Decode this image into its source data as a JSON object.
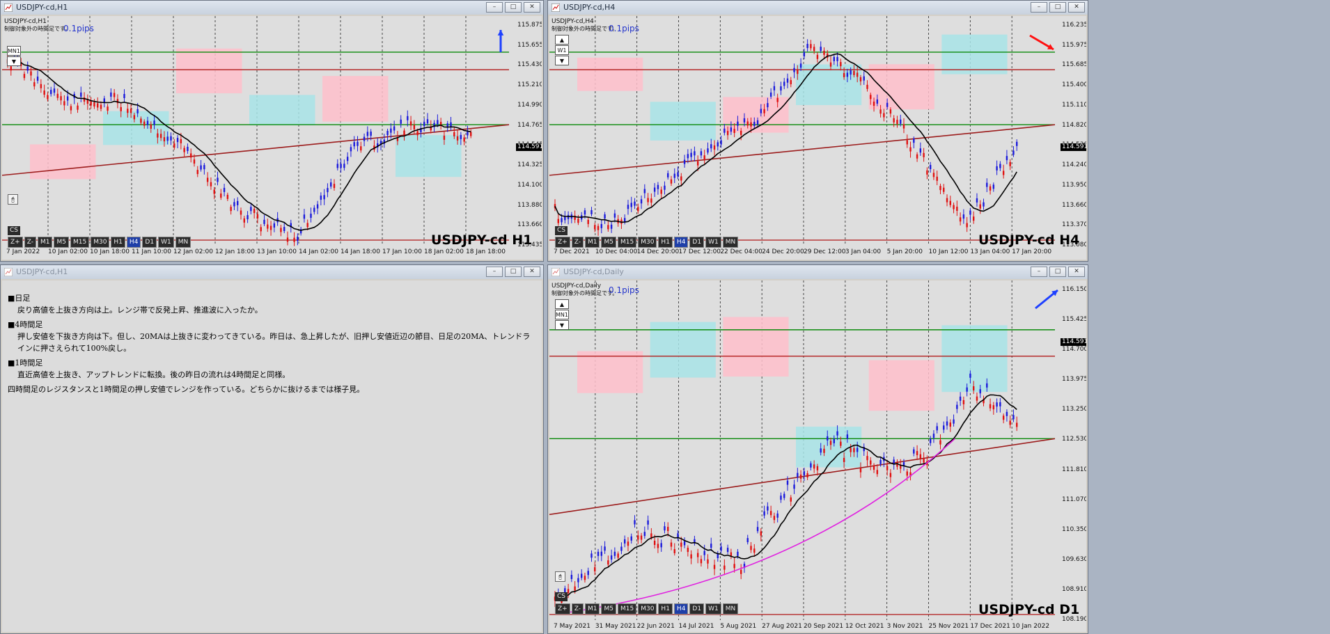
{
  "windows": {
    "h1": {
      "title": "USDJPY-cd,H1",
      "symbol_line": "USDJPY-cd,H1",
      "warning": "制御対象外の時間足です。",
      "pips": "0.1pips",
      "big_label": "USDJPY-cd H1",
      "current_price": "114.591",
      "tf_buttons": [
        "MN1"
      ],
      "y_ticks": [
        "115.875",
        "115.655",
        "115.430",
        "115.210",
        "114.990",
        "114.765",
        "114.545",
        "114.325",
        "114.100",
        "113.880",
        "113.660",
        "113.435"
      ],
      "x_ticks": [
        "7 Jan 2022",
        "10 Jan 02:00",
        "10 Jan 18:00",
        "11 Jan 10:00",
        "12 Jan 02:00",
        "12 Jan 18:00",
        "13 Jan 10:00",
        "14 Jan 02:00",
        "14 Jan 18:00",
        "17 Jan 10:00",
        "18 Jan 02:00",
        "18 Jan 18:00"
      ]
    },
    "h4": {
      "title": "USDJPY-cd,H4",
      "symbol_line": "USDJPY-cd,H4",
      "warning": "制御対象外の時間足です。",
      "pips": "0.1pips",
      "big_label": "USDJPY-cd H4",
      "current_price": "114.591",
      "tf_buttons": [
        "W1"
      ],
      "y_ticks": [
        "116.235",
        "115.975",
        "115.685",
        "115.400",
        "115.110",
        "114.820",
        "114.530",
        "114.240",
        "113.950",
        "113.660",
        "113.370",
        "113.080"
      ],
      "x_ticks": [
        "7 Dec 2021",
        "10 Dec 04:00",
        "14 Dec 20:00",
        "17 Dec 12:00",
        "22 Dec 04:00",
        "24 Dec 20:00",
        "29 Dec 12:00",
        "3 Jan 04:00",
        "5 Jan 20:00",
        "10 Jan 12:00",
        "13 Jan 04:00",
        "17 Jan 20:00"
      ]
    },
    "note": {
      "title": "USDJPY-cd,H1",
      "paragraphs": [
        {
          "head": "■日足",
          "body": "戻り高値を上抜き方向は上。レンジ帯で反発上昇、推進波に入ったか。"
        },
        {
          "head": "■4時間足",
          "body": "押し安値を下抜き方向は下。但し、20MAは上抜きに変わってきている。昨日は、急上昇したが、旧押し安値近辺の節目、日足の20MA、トレンドラインに押さえられて100%戻し。"
        },
        {
          "head": "■1時間足",
          "body": "直近高値を上抜き、アップトレンドに転換。後の昨日の流れは4時間足と同様。"
        },
        {
          "head": "",
          "body": "四時間足のレジスタンスと1時間足の押し安値でレンジを作っている。どちらかに抜けるまでは様子見。"
        }
      ]
    },
    "daily": {
      "title": "USDJPY-cd,Daily",
      "symbol_line": "USDJPY-cd,Daily",
      "warning": "制御対象外の時間足です。",
      "pips": "0.1pips",
      "big_label": "USDJPY-cd D1",
      "current_price": "114.591",
      "tf_buttons": [
        "MN1"
      ],
      "y_ticks": [
        "116.150",
        "115.425",
        "114.700",
        "113.975",
        "113.250",
        "112.530",
        "111.810",
        "111.070",
        "110.350",
        "109.630",
        "108.910",
        "108.190"
      ],
      "x_ticks": [
        "7 May 2021",
        "31 May 2021",
        "22 Jun 2021",
        "14 Jul 2021",
        "5 Aug 2021",
        "27 Aug 2021",
        "20 Sep 2021",
        "12 Oct 2021",
        "3 Nov 2021",
        "25 Nov 2021",
        "17 Dec 2021",
        "10 Jan 2022"
      ]
    }
  },
  "toolbar": {
    "buttons": [
      "Z+",
      "Z-",
      "M1",
      "M5",
      "M15",
      "M30",
      "H1",
      "H4",
      "D1",
      "W1",
      "MN"
    ],
    "active": "H4",
    "cs_label": "CS"
  },
  "window_buttons": {
    "minimize": "–",
    "maximize": "□",
    "close": "✕"
  },
  "colors": {
    "up_candle": "#1a1adb",
    "down_candle": "#e01010",
    "resistance": "#b01818",
    "support_green": "#0a8a0a",
    "ma20": "#000000",
    "ma200": "#e020e0",
    "zone_pink": "#ffc0cb",
    "zone_cyan": "#a8e4e8"
  }
}
